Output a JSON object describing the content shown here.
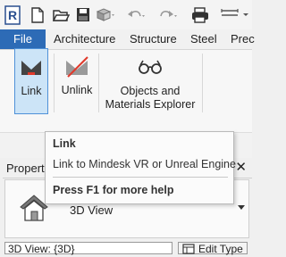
{
  "quick_access": {
    "icons": [
      "revit-logo-icon",
      "new-file-icon",
      "open-folder-icon",
      "save-icon",
      "sync-icon",
      "undo-icon",
      "redo-icon",
      "print-icon",
      "measure-icon"
    ],
    "logo_letter": "R"
  },
  "ribbon_tabs": [
    "File",
    "Architecture",
    "Structure",
    "Steel",
    "Prec"
  ],
  "ribbon": {
    "buttons": {
      "link": "Link",
      "unlink": "Unlink",
      "objects_line1": "Objects and",
      "objects_line2": "Materials Explorer"
    }
  },
  "tooltip": {
    "title": "Link",
    "description": "Link to Mindesk VR or Unreal Engine",
    "help": "Press F1 for more help"
  },
  "properties": {
    "title": "Properties",
    "close": "✕",
    "type_name": "3D View",
    "instance_value": "3D View: {3D}",
    "edit_type_label": "Edit Type"
  },
  "colors": {
    "file_tab": "#2d6bb6",
    "selected_button": "#cce4f7",
    "link_icon_red": "#e0392b"
  }
}
